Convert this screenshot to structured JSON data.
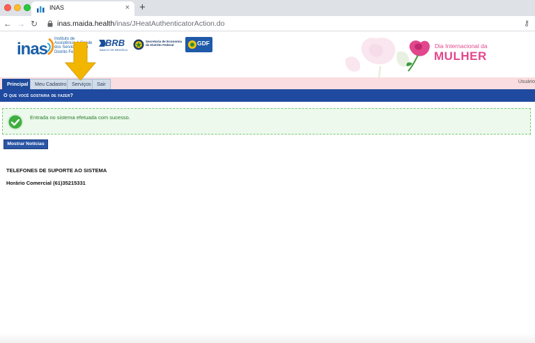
{
  "browser": {
    "tab_title": "INAS",
    "tab_close": "×",
    "new_tab": "+",
    "url_host": "inas.maida.health",
    "url_path": "/inas/JHeatAuthenticatorAction.do",
    "back": "←",
    "forward": "→",
    "reload": "↻",
    "key_icon": "⚷"
  },
  "header": {
    "inas_word": "inas",
    "inas_tagline": "Instituto de Assistência à Saúde dos Servidores do Distrito Federal",
    "brb_word": "BRB",
    "brb_sub": "BANCO DE BRASÍLIA",
    "secretaria": "Secretaria de Economia do Distrito Federal",
    "gdf": "GDF",
    "campaign_line1": "Dia Internacional da",
    "campaign_line2": "MULHER",
    "colors": {
      "inas_blue": "#1b5fa6",
      "campaign_pink": "#e2478d"
    }
  },
  "menu": {
    "tabs": [
      {
        "label": "Principal",
        "active": true
      },
      {
        "label": "Meu Cadastro",
        "active": false
      },
      {
        "label": "Serviços",
        "active": false
      },
      {
        "label": "Sair",
        "active": false
      }
    ],
    "user_label": "Usuário"
  },
  "section": {
    "title": "O que você gostaria de fazer?"
  },
  "message": {
    "success": "Entrada no sistema efetuada com sucesso."
  },
  "buttons": {
    "news": "Mostrar Notícias"
  },
  "support": {
    "title": "TELEFONES DE SUPORTE AO SISTEMA",
    "hours": "Horário Comercial (61)35215331"
  },
  "annotation": {
    "icon": "arrow-down-icon",
    "color": "#f2b600"
  }
}
